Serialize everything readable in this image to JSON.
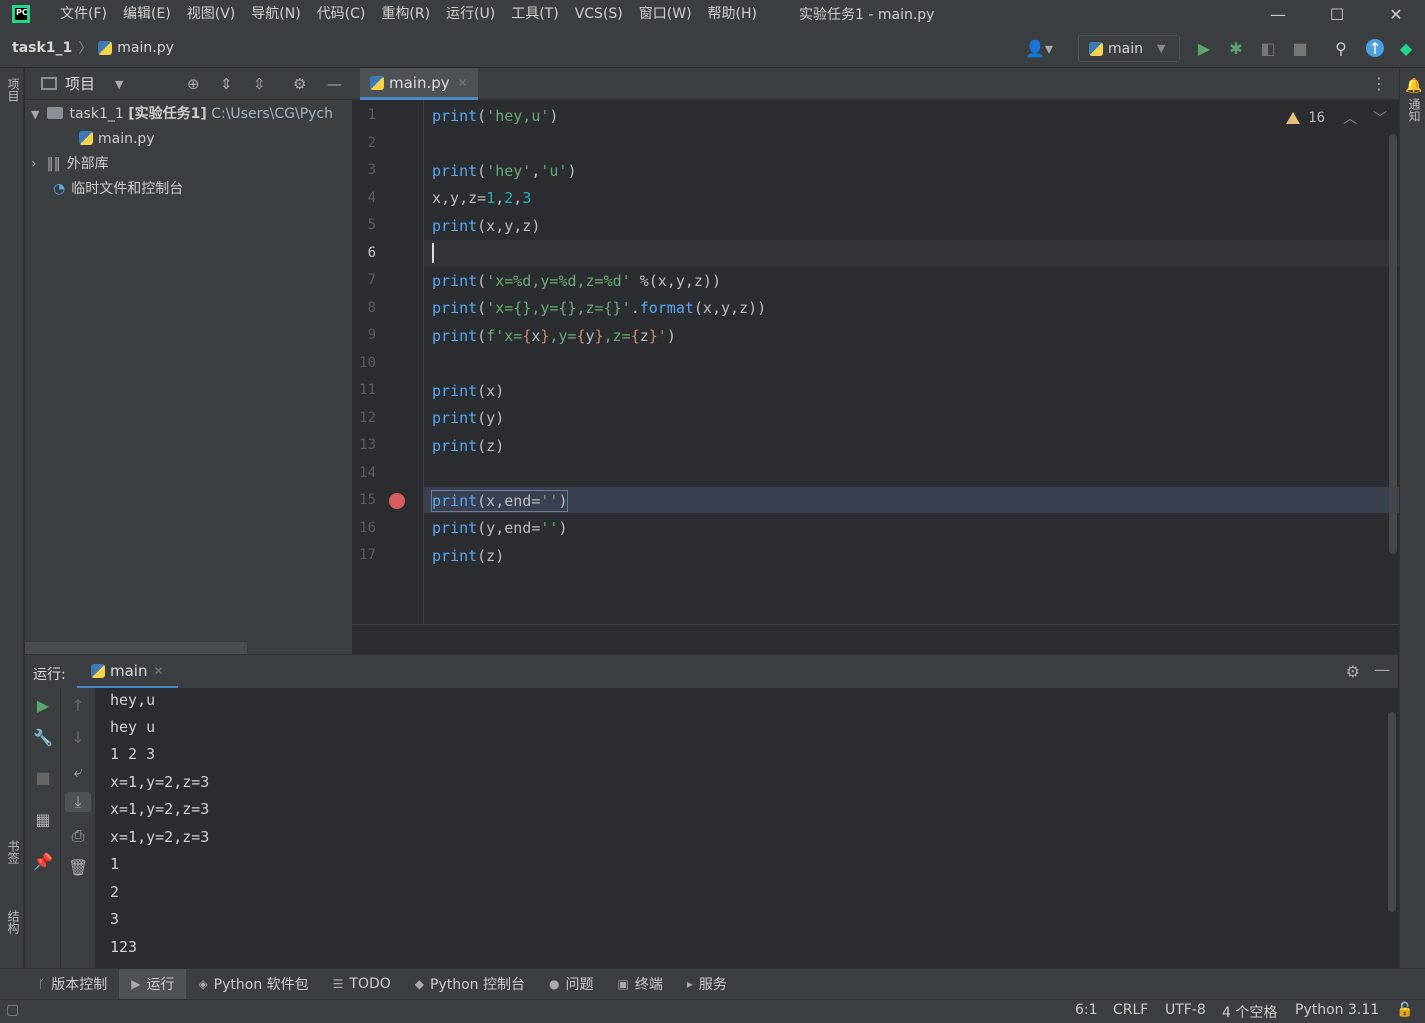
{
  "titlebar": {
    "app_logo": "PC",
    "menu": [
      "文件(F)",
      "编辑(E)",
      "视图(V)",
      "导航(N)",
      "代码(C)",
      "重构(R)",
      "运行(U)",
      "工具(T)",
      "VCS(S)",
      "窗口(W)",
      "帮助(H)"
    ],
    "window_title": "实验任务1 - main.py",
    "controls": {
      "minimize": "—",
      "maximize": "☐",
      "close": "✕"
    }
  },
  "navbar": {
    "project": "task1_1",
    "separator": "〉",
    "file": "main.py",
    "run_config": "main"
  },
  "left_stripe": {
    "project_tab": "项目",
    "bookmarks_tab": "书签",
    "structure_tab": "结构"
  },
  "right_stripe": {
    "notifications_tab": "通知"
  },
  "project_panel": {
    "title": "项目",
    "tree": [
      {
        "label": "task1_1",
        "tag": "[实验任务1]",
        "path": "C:\\Users\\CG\\Pych"
      },
      {
        "label": "main.py"
      },
      {
        "label": "外部库"
      },
      {
        "label": "临时文件和控制台"
      }
    ]
  },
  "editor": {
    "tab_label": "main.py",
    "warning_count": "16",
    "line_numbers": [
      "1",
      "2",
      "3",
      "4",
      "5",
      "6",
      "7",
      "8",
      "9",
      "10",
      "11",
      "12",
      "13",
      "14",
      "15",
      "16",
      "17"
    ],
    "current_line": 6,
    "breakpoint_line": 15
  },
  "run_panel": {
    "label": "运行:",
    "tab": "main",
    "output": [
      "hey,u",
      "hey u",
      "1 2 3",
      "x=1,y=2,z=3",
      "x=1,y=2,z=3",
      "x=1,y=2,z=3",
      "1",
      "2",
      "3",
      "123"
    ]
  },
  "tool_windows": [
    {
      "label": "版本控制",
      "icon": "branch-icon"
    },
    {
      "label": "运行",
      "icon": "run-icon",
      "active": true
    },
    {
      "label": "Python 软件包",
      "icon": "layers-icon"
    },
    {
      "label": "TODO",
      "icon": "list-icon"
    },
    {
      "label": "Python 控制台",
      "icon": "python-icon"
    },
    {
      "label": "问题",
      "icon": "info-icon"
    },
    {
      "label": "终端",
      "icon": "terminal-icon"
    },
    {
      "label": "服务",
      "icon": "services-icon"
    }
  ],
  "statusbar": {
    "position": "6:1",
    "line_sep": "CRLF",
    "encoding": "UTF-8",
    "indent": "4 个空格",
    "interpreter": "Python 3.11"
  },
  "colors": {
    "accent": "#4a88c7",
    "run_green": "#59a869",
    "breakpoint": "#db5c5c",
    "warning": "#e5c07b"
  }
}
